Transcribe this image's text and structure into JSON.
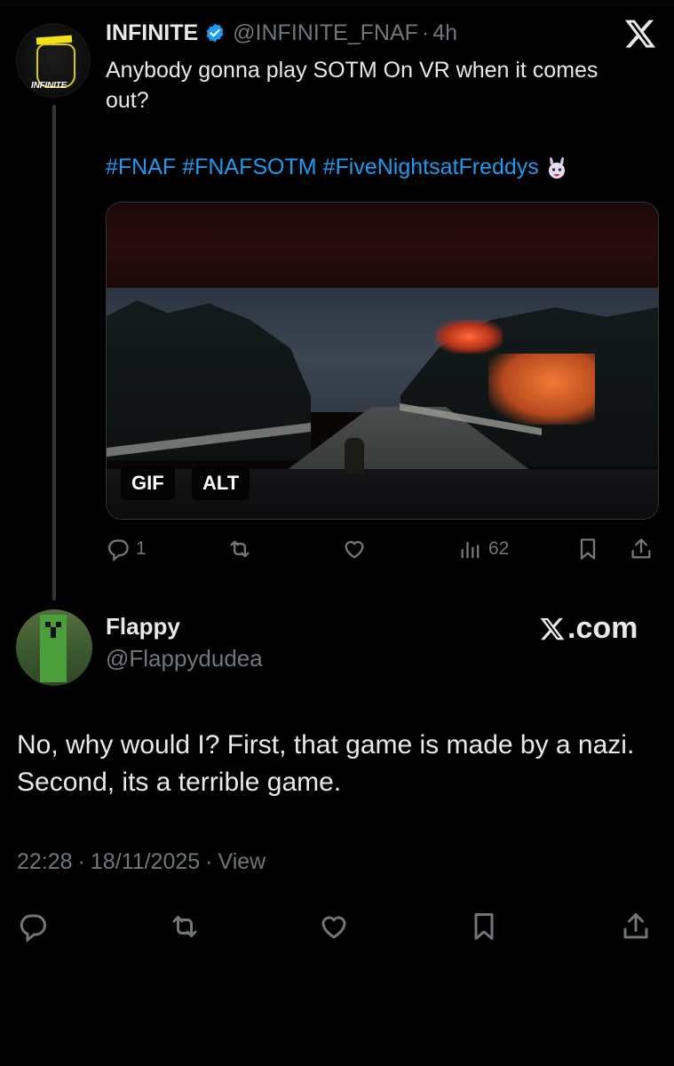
{
  "tweet": {
    "author_name": "INFINITE",
    "avatar_label": "INFINITE",
    "handle": "@INFINITE_FNAF",
    "separator": "·",
    "time": "4h",
    "text": "Anybody gonna play SOTM On VR when it comes out?",
    "hashtags": [
      "#FNAF",
      "#FNAFSOTM",
      "#FiveNightsatFreddys"
    ],
    "emoji_icon": "bunny-emoji-icon",
    "media": {
      "gif_badge": "GIF",
      "alt_badge": "ALT"
    },
    "actions": {
      "reply_count": "1",
      "retweet_count": "",
      "like_count": "",
      "views_count": "62"
    }
  },
  "reply": {
    "author_name": "Flappy",
    "handle": "@Flappydudea",
    "source": ".com",
    "text": "No, why would I? First, that game is made by a nazi. Second, its a terrible game.",
    "time": "22:28",
    "separator": "·",
    "date": "18/11/2025",
    "views_label": "View"
  },
  "colors": {
    "background": "#000000",
    "text": "#e7e9ea",
    "muted": "#71767b",
    "link": "#1d9bf0",
    "verified": "#1d9bf0"
  }
}
